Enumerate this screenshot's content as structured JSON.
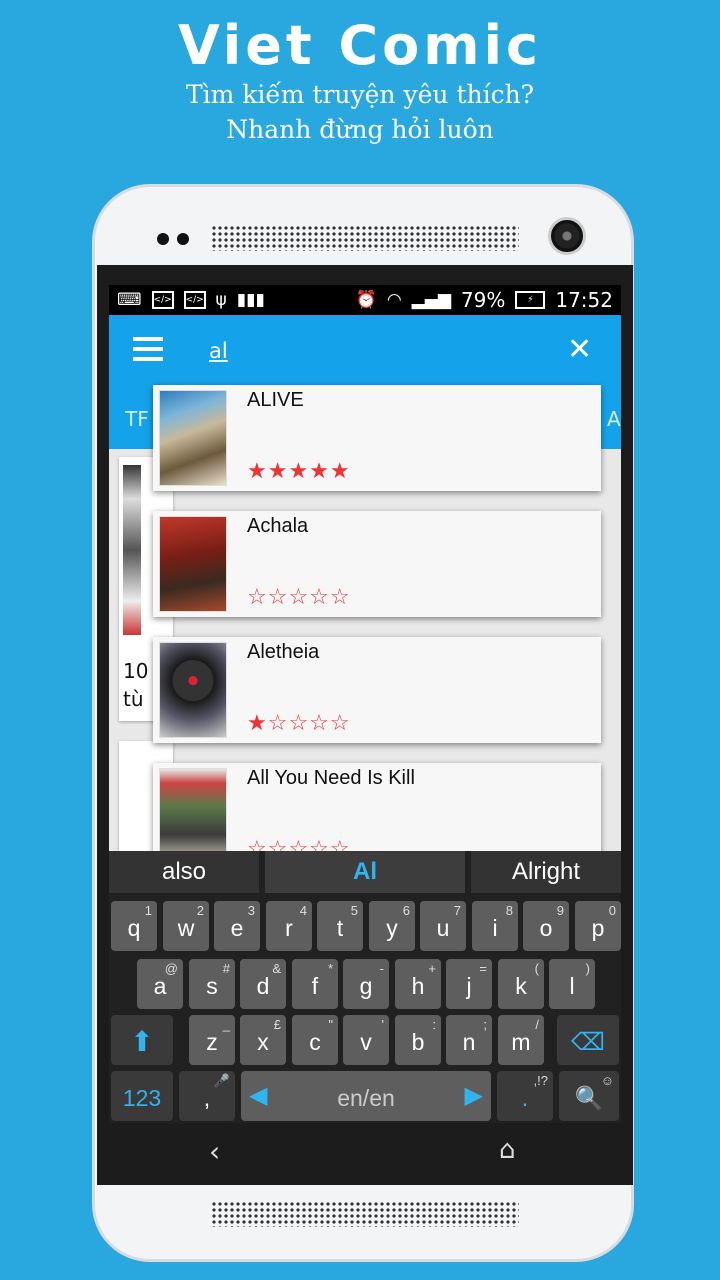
{
  "promo": {
    "title": "Viet Comic",
    "line1": "Tìm kiếm truyện yêu thích?",
    "line2": "Nhanh đừng hỏi luôn"
  },
  "status_bar": {
    "battery": "79%",
    "time": "17:52",
    "icons": [
      "keyboard-icon",
      "code-icon",
      "code-icon",
      "usb-icon",
      "barcode-icon",
      "alarm-icon",
      "wifi-icon",
      "signal-icon",
      "battery-icon"
    ]
  },
  "search": {
    "query": "al"
  },
  "tabs": {
    "left_fragment": "TF",
    "right_fragment": "Al"
  },
  "background_card": {
    "line1": "10",
    "line2": "tù"
  },
  "results": [
    {
      "title": "ALIVE",
      "rating": 5,
      "max": 5
    },
    {
      "title": "Achala",
      "rating": 0,
      "max": 5
    },
    {
      "title": "Aletheia",
      "rating": 1,
      "max": 5
    },
    {
      "title": "All You Need Is Kill",
      "rating": 0,
      "max": 5
    }
  ],
  "keyboard": {
    "suggestions": [
      "also",
      "Al",
      "Alright"
    ],
    "row1": [
      [
        "q",
        "1"
      ],
      [
        "w",
        "2"
      ],
      [
        "e",
        "3"
      ],
      [
        "r",
        "4"
      ],
      [
        "t",
        "5"
      ],
      [
        "y",
        "6"
      ],
      [
        "u",
        "7"
      ],
      [
        "i",
        "8"
      ],
      [
        "o",
        "9"
      ],
      [
        "p",
        "0"
      ]
    ],
    "row2": [
      [
        "a",
        "@"
      ],
      [
        "s",
        "#"
      ],
      [
        "d",
        "&"
      ],
      [
        "f",
        "*"
      ],
      [
        "g",
        "-"
      ],
      [
        "h",
        "+"
      ],
      [
        "j",
        "="
      ],
      [
        "k",
        "("
      ],
      [
        "l",
        ")"
      ]
    ],
    "row3": [
      [
        "z",
        "_"
      ],
      [
        "x",
        "£"
      ],
      [
        "c",
        "\""
      ],
      [
        "v",
        "'"
      ],
      [
        "b",
        ":"
      ],
      [
        "n",
        ";"
      ],
      [
        "m",
        "/"
      ]
    ],
    "numbers_label": "123",
    "comma": ",",
    "language": "en/en",
    "period": ".",
    "period_sup": ",!?",
    "accent_color": "#2fb4f0"
  }
}
